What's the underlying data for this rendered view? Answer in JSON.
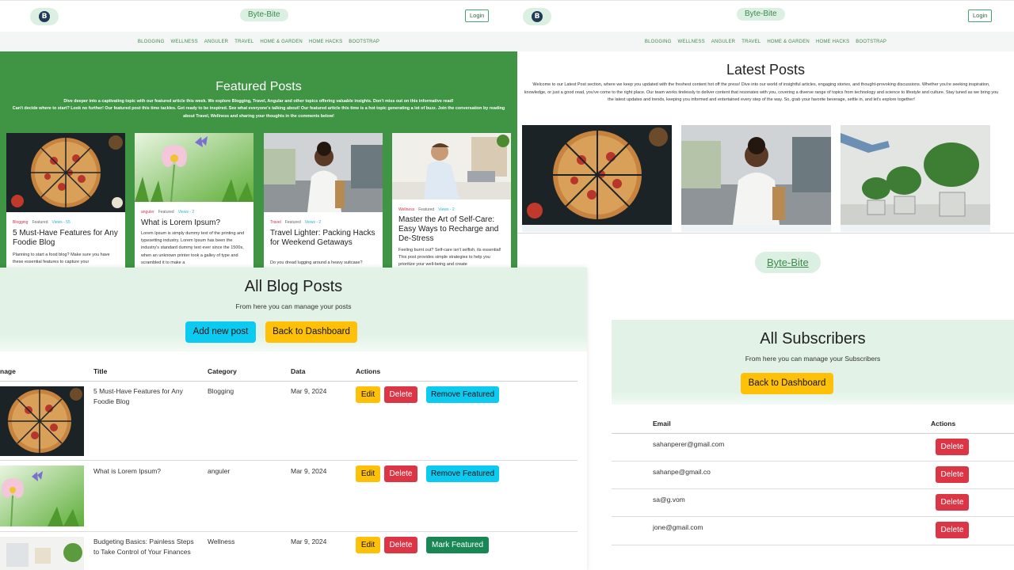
{
  "home": {
    "brand": "Byte-Bite",
    "login": "Login",
    "logo_letter": "B",
    "nav": [
      "BLOGGING",
      "WELLNESS",
      "ANGULER",
      "TRAVEL",
      "HOME & GARDEN",
      "HOME HACKS",
      "BOOTSTRAP"
    ],
    "featured_title": "Featured Posts",
    "featured_desc_1": "Dive deeper into a captivating topic with our featured article this week. We explore Blogging, Travel, Angular and other topics offering valuable insights. Don't miss out on this informative read!",
    "featured_desc_2": "Can't decide where to start? Look no further! Our featured post this time tackles. Get ready to be inspired. See what everyone's talking about! Our featured article this time is a hot topic generating a lot of buzz. Join the conversation by reading about Travel, Wellness and sharing your thoughts in the comments below!",
    "cards": [
      {
        "category": "Blogging",
        "featured": "Featured",
        "views": "Views - 55",
        "title": "5 Must-Have Features for Any Foodie Blog",
        "excerpt": "Planning to start a food blog? Make sure you have these essential features to capture your"
      },
      {
        "category": "anguler",
        "featured": "Featured",
        "views": "Views - 2",
        "title": "What is Lorem Ipsum?",
        "excerpt": "Lorem Ipsum is simply dummy text of the printing and typesetting industry. Lorem Ipsum has been the industry's standard dummy text ever since the 1500s, when an unknown printer took a galley of type and scrambled it to make a"
      },
      {
        "category": "Travel",
        "featured": "Featured",
        "views": "Views - 2",
        "title": "Travel Lighter: Packing Hacks for Weekend Getaways",
        "excerpt": "Do you dread lugging around a heavy suitcase?"
      },
      {
        "category": "Wellness",
        "featured": "Featured",
        "views": "Views - 2",
        "title": "Master the Art of Self-Care: Easy Ways to Recharge and De-Stress",
        "excerpt": "Feeling burnt out? Self-care isn't selfish, its essential! This post provides simple strategies to help you prioritize your well-being and create"
      }
    ]
  },
  "latest": {
    "brand": "Byte-Bite",
    "login": "Login",
    "logo_letter": "B",
    "nav": [
      "BLOGGING",
      "WELLNESS",
      "ANGULER",
      "TRAVEL",
      "HOME & GARDEN",
      "HOME HACKS",
      "BOOTSTRAP"
    ],
    "title": "Latest Posts",
    "desc": "Welcome to our Latest Post section, where we keep you updated with the freshest content hot off the press! Dive into our world of insightful articles, engaging stories, and thought-provoking discussions. Whether you're seeking inspiration, knowledge, or just a good read, you've come to the right place. Our team works tirelessly to deliver content that resonates with you, covering a diverse range of topics from technology and science to lifestyle and culture. Stay tuned as we bring you the latest updates and trends, keeping you informed and entertained every step of the way. So, grab your favorite beverage, settle in, and let's explore together!",
    "footer_brand": "Byte-Bite"
  },
  "posts_admin": {
    "title": "All Blog Posts",
    "subtitle": "From here you can manage your posts",
    "add_btn": "Add new post",
    "back_btn": "Back to Dashboard",
    "columns": [
      "nage",
      "Title",
      "Category",
      "Data",
      "Actions"
    ],
    "rows": [
      {
        "title": "5 Must-Have Features for Any Foodie Blog",
        "category": "Blogging",
        "date": "Mar 9, 2024",
        "edit": "Edit",
        "delete": "Delete",
        "feature_action": "Remove Featured"
      },
      {
        "title": "What is Lorem Ipsum?",
        "category": "anguler",
        "date": "Mar 9, 2024",
        "edit": "Edit",
        "delete": "Delete",
        "feature_action": "Remove Featured"
      },
      {
        "title": "Budgeting Basics: Painless Steps to Take Control of Your Finances",
        "category": "Wellness",
        "date": "Mar 9, 2024",
        "edit": "Edit",
        "delete": "Delete",
        "feature_action": "Mark Featured"
      }
    ]
  },
  "subscribers": {
    "title": "All Subscribers",
    "subtitle": "From here you can manage your Subscribers",
    "back_btn": "Back to Dashboard",
    "columns": [
      "Email",
      "Actions"
    ],
    "rows": [
      {
        "email": "sahanperer@gmail.com",
        "delete": "Delete"
      },
      {
        "email": "sahanpe@gmail.co",
        "delete": "Delete"
      },
      {
        "email": "sa@g.vom",
        "delete": "Delete"
      },
      {
        "email": "jone@gmail.com",
        "delete": "Delete"
      }
    ]
  },
  "colors": {
    "brand_green": "#3f9544",
    "mint": "#dbefe2",
    "edit": "#ffc107",
    "delete": "#dc3545",
    "remove_featured": "#0dcaf0",
    "mark_featured": "#198754"
  }
}
